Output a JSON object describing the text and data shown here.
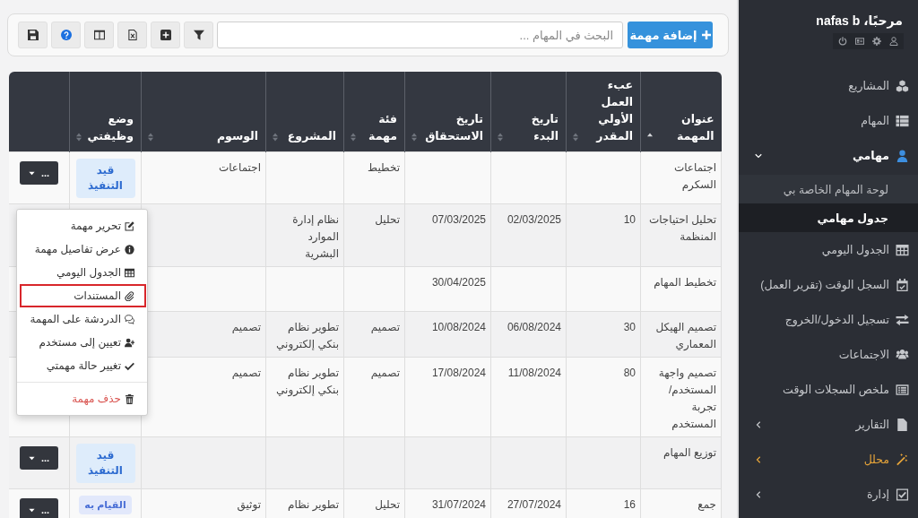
{
  "toolbar": {
    "add_button": "إضافة مهمة",
    "search": {
      "placeholder": "البحث في المهام ..."
    },
    "tools": [
      {
        "kind": "filter"
      },
      {
        "kind": "add"
      },
      {
        "kind": "spreadsheet"
      },
      {
        "kind": "columns"
      },
      {
        "kind": "help"
      },
      {
        "kind": "save"
      }
    ]
  },
  "table": {
    "columns": [
      {
        "label": "عنوان المهمة",
        "sorted": true
      },
      {
        "label": "عبء العمل الأولي المقدر",
        "sorted": false
      },
      {
        "label": "تاريخ البدء",
        "sorted": false
      },
      {
        "label": "تاريخ الاستحقاق",
        "sorted": false
      },
      {
        "label": "فئة مهمة",
        "sorted": false
      },
      {
        "label": "المشروع",
        "sorted": false
      },
      {
        "label": "الوسوم",
        "sorted": false
      },
      {
        "label": "وضع وظيفتي",
        "sorted": false
      }
    ],
    "rows": [
      {
        "title": "اجتماعات السكرم",
        "category": "تخطيط",
        "tags": "اجتماعات",
        "status": {
          "label": "قيد التنفيذ",
          "kind": "in_progress"
        },
        "actions": "..."
      },
      {
        "title": "تحليل احتياجات المنظمة",
        "workload": "10",
        "start_date": "02/03/2025",
        "due_date": "07/03/2025",
        "category": "تحليل",
        "project": "نظام إدارة الموارد البشرية"
      },
      {
        "title": "تخطيط المهام",
        "due_date": "30/04/2025"
      },
      {
        "title": "تصميم الهيكل المعماري",
        "workload": "30",
        "start_date": "06/08/2024",
        "due_date": "10/08/2024",
        "category": "تصميم",
        "project": "تطوير نظام بنكي إلكتروني",
        "tags": "تصميم"
      },
      {
        "title": "تصميم واجهة المستخدم/ تجربة المستخدم",
        "workload": "80",
        "start_date": "11/08/2024",
        "due_date": "17/08/2024",
        "category": "تصميم",
        "project": "تطوير نظام بنكي إلكتروني",
        "tags": "تصميم"
      },
      {
        "title": "توزيع المهام",
        "status": {
          "label": "قيد التنفيذ",
          "kind": "in_progress"
        },
        "actions": "..."
      },
      {
        "title": "جمع",
        "workload": "16",
        "start_date": "27/07/2024",
        "due_date": "31/07/2024",
        "category": "تحليل",
        "project": "تطوير نظام",
        "tags": "توثيق",
        "status": {
          "label": "القيام به",
          "kind": "todo"
        },
        "actions": "..."
      }
    ],
    "row_menu": {
      "items": [
        {
          "label": "تحرير مهمة",
          "kind": "edit",
          "highlighted": false
        },
        {
          "label": "عرض تفاصيل مهمة",
          "kind": "details",
          "highlighted": false
        },
        {
          "label": "الجدول اليومي",
          "kind": "daily",
          "highlighted": false
        },
        {
          "label": "المستندات",
          "kind": "documents",
          "highlighted": true
        },
        {
          "label": "الدردشة على المهمة",
          "kind": "chat",
          "highlighted": false
        },
        {
          "label": "تعيين إلى مستخدم",
          "kind": "assign",
          "highlighted": false
        },
        {
          "label": "تغيير حالة مهمتي",
          "kind": "status",
          "highlighted": false
        },
        {
          "label": "حذف مهمة",
          "kind": "delete",
          "highlighted": false
        }
      ]
    }
  },
  "sidebar": {
    "greeting": "مرحبًا، nafas b",
    "account_icons": [
      {
        "kind": "user"
      },
      {
        "kind": "settings"
      },
      {
        "kind": "card"
      },
      {
        "kind": "power"
      }
    ],
    "nav": [
      {
        "label": "المشاريع",
        "kind": "projects",
        "selected": false,
        "highlighted": false
      },
      {
        "label": "المهام",
        "kind": "tasks",
        "selected": false,
        "highlighted": false
      },
      {
        "label": "مهامي",
        "kind": "mytasks",
        "selected": true,
        "highlighted": false,
        "expanded": true,
        "children": [
          {
            "label": "لوحة المهام الخاصة بي",
            "selected": false
          },
          {
            "label": "جدول مهامي",
            "selected": true
          }
        ]
      },
      {
        "label": "الجدول اليومي",
        "kind": "daily",
        "selected": false,
        "highlighted": false
      },
      {
        "label": "السجل الوقت (تقرير العمل)",
        "kind": "timelog",
        "selected": false,
        "highlighted": false
      },
      {
        "label": "تسجيل الدخول/الخروج",
        "kind": "checkin",
        "selected": false,
        "highlighted": false
      },
      {
        "label": "الاجتماعات",
        "kind": "meetings",
        "selected": false,
        "highlighted": false
      },
      {
        "label": "ملخص السجلات الوقت",
        "kind": "summary",
        "selected": false,
        "highlighted": false
      },
      {
        "label": "التقارير",
        "kind": "reports",
        "selected": false,
        "highlighted": false,
        "expanded": false
      },
      {
        "label": "محلل",
        "kind": "analyst",
        "selected": false,
        "highlighted": true,
        "expanded": false
      },
      {
        "label": "إدارة",
        "kind": "admin",
        "selected": false,
        "highlighted": false,
        "expanded": false
      }
    ]
  }
}
